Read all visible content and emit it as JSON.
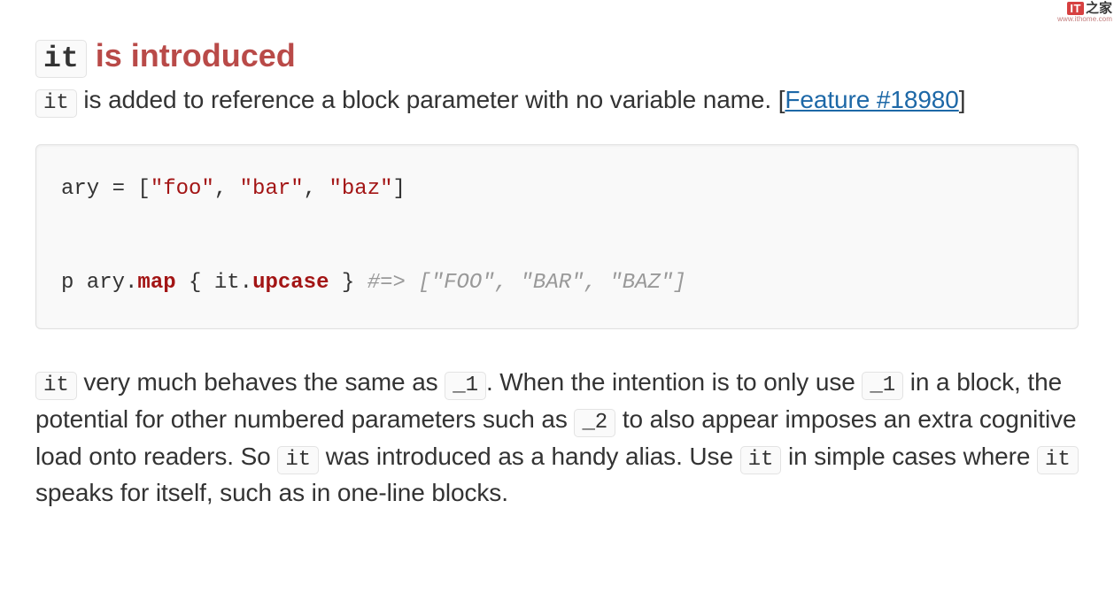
{
  "watermark": {
    "logo_text": "IT",
    "logo_glyph": "之家",
    "url": "www.ithome.com"
  },
  "heading": {
    "code": "it",
    "rest": " is introduced"
  },
  "intro": {
    "code1": "it",
    "text1": " is added to reference a block parameter with no variable name. [",
    "link": "Feature #18980",
    "text2": "]"
  },
  "code": {
    "l1_a": "ary = [",
    "l1_s1": "\"foo\"",
    "l1_b": ", ",
    "l1_s2": "\"bar\"",
    "l1_c": ", ",
    "l1_s3": "\"baz\"",
    "l1_d": "]",
    "l2_a": "p ary.",
    "l2_m1": "map",
    "l2_b": " { it.",
    "l2_m2": "upcase",
    "l2_c": " } ",
    "l2_com": "#=> [\"FOO\", \"BAR\", \"BAZ\"]"
  },
  "explain": {
    "c1": "it",
    "t1": " very much behaves the same as ",
    "c2": "_1",
    "t2": ". When the intention is to only use ",
    "c3": "_1",
    "t3": " in a block, the potential for other numbered parameters such as ",
    "c4": "_2",
    "t4": " to also appear imposes an extra cognitive load onto readers. So ",
    "c5": "it",
    "t5": " was introduced as a handy alias. Use ",
    "c6": "it",
    "t6": " in simple cases where ",
    "c7": "it",
    "t7": " speaks for itself, such as in one-line blocks."
  }
}
